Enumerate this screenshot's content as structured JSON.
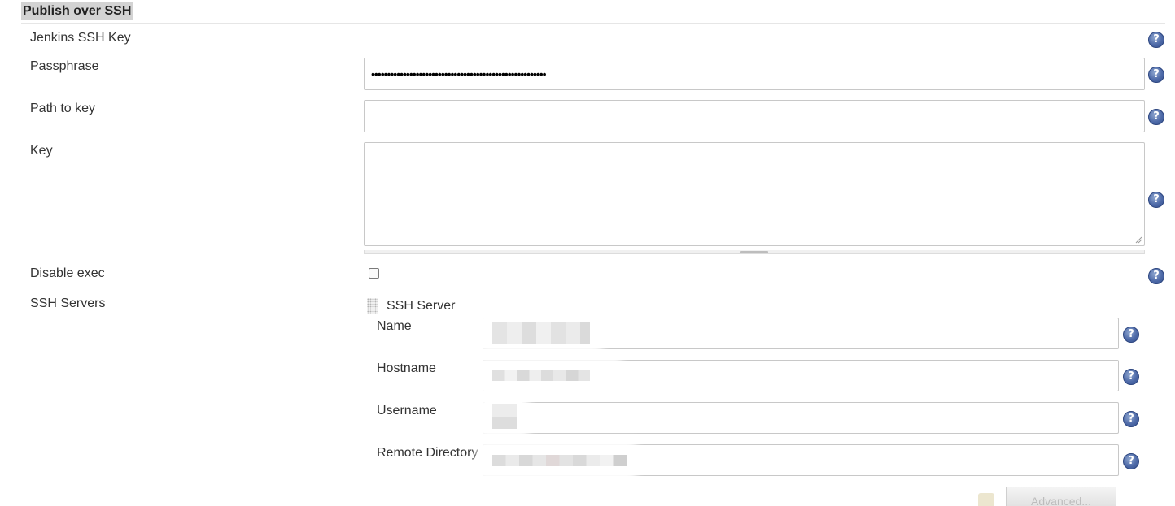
{
  "section": {
    "title": "Publish over SSH"
  },
  "fields": {
    "jenkins_ssh_key": {
      "label": "Jenkins SSH Key"
    },
    "passphrase": {
      "label": "Passphrase",
      "masked_value": "•••••••••••••••••••••••••••••••••••••••••••••••••••••••"
    },
    "path_to_key": {
      "label": "Path to key",
      "value": ""
    },
    "key": {
      "label": "Key",
      "value": ""
    },
    "disable_exec": {
      "label": "Disable exec",
      "checked": false
    },
    "ssh_servers": {
      "label": "SSH Servers"
    }
  },
  "ssh_server": {
    "heading": "SSH Server",
    "name": {
      "label": "Name"
    },
    "hostname": {
      "label": "Hostname"
    },
    "username": {
      "label": "Username"
    },
    "remote_directory": {
      "label": "Remote Directory"
    },
    "advanced_label": "Advanced..."
  },
  "help": {
    "glyph": "?"
  },
  "colors": {
    "help_icon": "#4e6aa8",
    "section_header_bg": "#d3d3d3",
    "input_border": "#c8c8c8"
  }
}
